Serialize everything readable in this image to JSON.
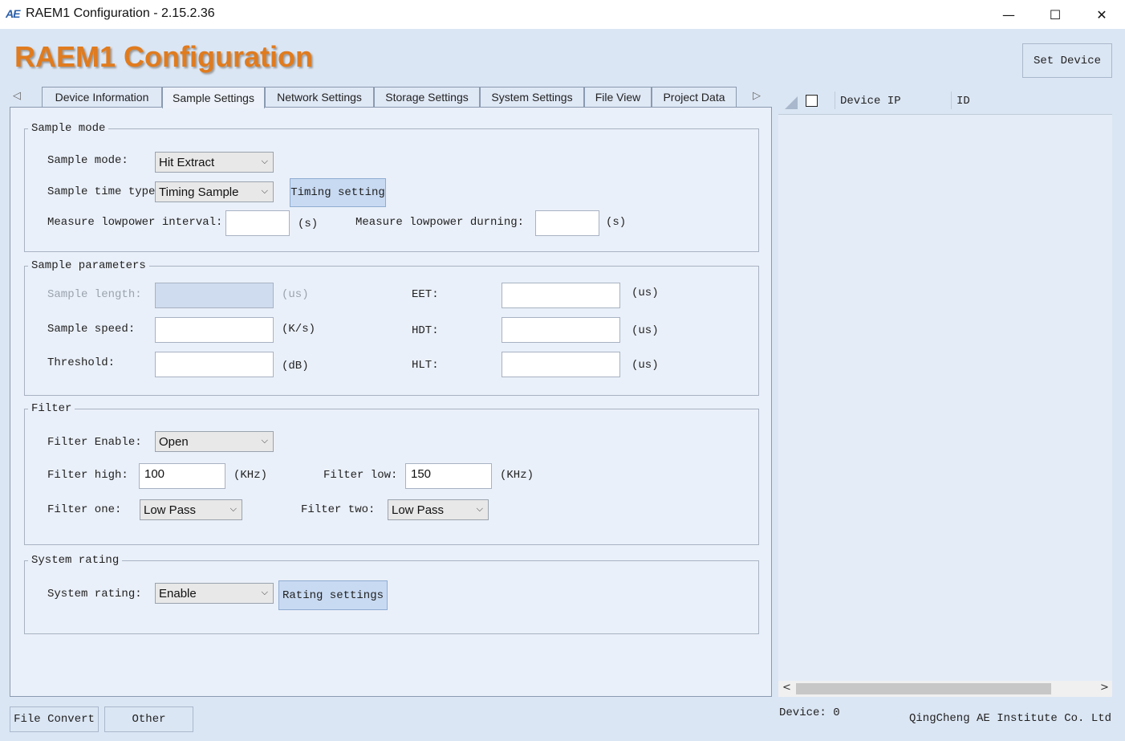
{
  "window": {
    "title": "RAEM1 Configuration - 2.15.2.36",
    "logo_text": "AE",
    "min_glyph": "—",
    "max_glyph": "☐",
    "close_glyph": "✕"
  },
  "header": {
    "app_title": "RAEM1 Configuration",
    "set_device_label": "Set Device"
  },
  "tabs": {
    "prev_glyph": "◁",
    "next_glyph": "▷",
    "items": [
      "Device Information",
      "Sample Settings",
      "Network Settings",
      "Storage Settings",
      "System Settings",
      "File View",
      "Project Data"
    ],
    "active": "Sample Settings"
  },
  "sample_mode": {
    "legend": "Sample mode",
    "mode_label": "Sample mode:",
    "mode_value": "Hit Extract",
    "time_type_label": "Sample time type:",
    "time_type_value": "Timing Sample",
    "timing_button": "Timing setting",
    "lowpower_interval_label": "Measure lowpower interval:",
    "lowpower_interval_value": "",
    "lowpower_interval_unit": "(s)",
    "lowpower_during_label": "Measure lowpower durning:",
    "lowpower_during_value": "",
    "lowpower_during_unit": "(s)"
  },
  "sample_parameters": {
    "legend": "Sample parameters",
    "length_label": "Sample length:",
    "length_value": "",
    "length_unit": "(us)",
    "speed_label": "Sample speed:",
    "speed_value": "",
    "speed_unit": "(K/s)",
    "threshold_label": "Threshold:",
    "threshold_value": "",
    "threshold_unit": "(dB)",
    "eet_label": "EET:",
    "eet_value": "",
    "eet_unit": "(us)",
    "hdt_label": "HDT:",
    "hdt_value": "",
    "hdt_unit": "(us)",
    "hlt_label": "HLT:",
    "hlt_value": "",
    "hlt_unit": "(us)"
  },
  "filter": {
    "legend": "Filter",
    "enable_label": "Filter Enable:",
    "enable_value": "Open",
    "high_label": "Filter high:",
    "high_value": "100",
    "high_unit": "(KHz)",
    "low_label": "Filter low:",
    "low_value": "150",
    "low_unit": "(KHz)",
    "one_label": "Filter one:",
    "one_value": "Low Pass",
    "two_label": "Filter two:",
    "two_value": "Low Pass"
  },
  "system_rating": {
    "legend": "System rating",
    "label": "System rating:",
    "value": "Enable",
    "button": "Rating settings"
  },
  "device_grid": {
    "col_ip": "Device IP",
    "col_id": "ID",
    "scroll_left": "<",
    "scroll_right": ">"
  },
  "footer": {
    "file_convert": "File Convert",
    "other": "Other",
    "device_count": "Device: 0",
    "company": "QingCheng AE Institute Co. Ltd"
  },
  "chevron": "⌵"
}
